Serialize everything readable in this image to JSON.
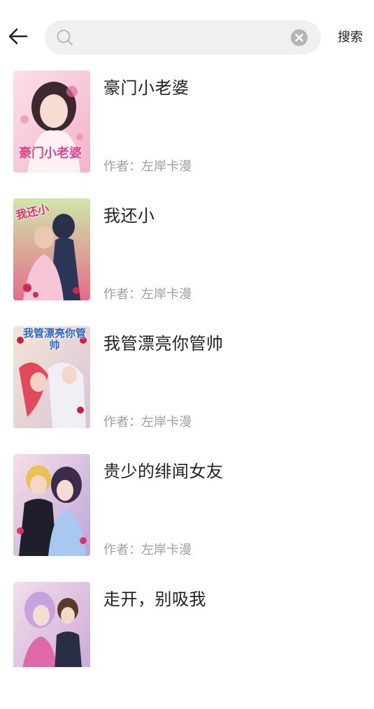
{
  "header": {
    "search_placeholder": "",
    "search_value": "",
    "search_button": "搜索"
  },
  "books": [
    {
      "title": "豪门小老婆",
      "author": "作者：左岸卡漫",
      "cover_text": "豪门小老婆"
    },
    {
      "title": "我还小",
      "author": "作者：左岸卡漫",
      "cover_text": "我还小"
    },
    {
      "title": "我管漂亮你管帅",
      "author": "作者：左岸卡漫",
      "cover_text": "我管漂亮你管帅"
    },
    {
      "title": "贵少的绯闻女友",
      "author": "作者：左岸卡漫",
      "cover_text": ""
    },
    {
      "title": "走开，别吸我",
      "author": "",
      "cover_text": ""
    }
  ],
  "colors": {
    "search_bg": "#f0f0f0",
    "author_gray": "#9e9e9e",
    "title_dark": "#222222"
  }
}
